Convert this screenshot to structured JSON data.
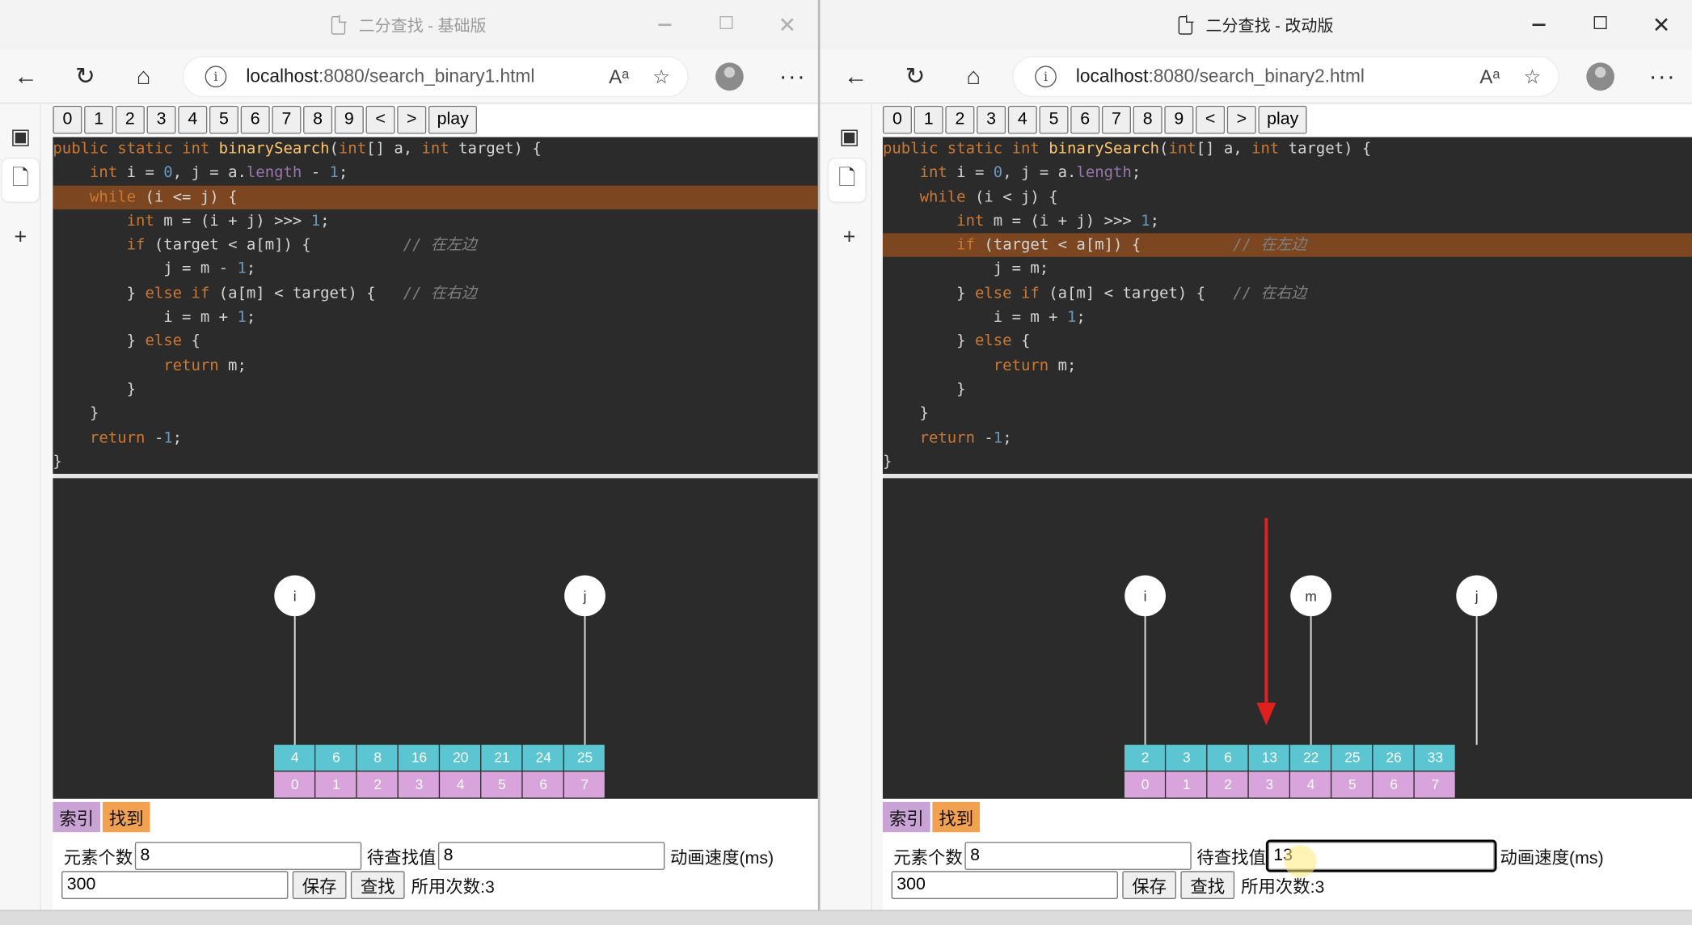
{
  "colors": {
    "code_bg": "#2b2b2b",
    "highlight": "#7b4620",
    "value_cell": "#5bc6d1",
    "index_cell": "#d9a3dc",
    "arrow": "#e0201e",
    "legend_index": "#c9a2d6",
    "legend_found": "#f2a151"
  },
  "left": {
    "title": "二分查找 - 基础版",
    "url_host": "localhost",
    "url_path": ":8080/search_binary1.html",
    "buttons": [
      "0",
      "1",
      "2",
      "3",
      "4",
      "5",
      "6",
      "7",
      "8",
      "9",
      "<",
      ">",
      "play"
    ],
    "code_lines": [
      "public static int binarySearch(int[] a, int target) {",
      "    int i = 0, j = a.length - 1;",
      "    while (i <= j) {",
      "        int m = (i + j) >>> 1;",
      "        if (target < a[m]) {          // 在左边",
      "            j = m - 1;",
      "        } else if (a[m] < target) {   // 在右边",
      "            i = m + 1;",
      "        } else {",
      "            return m;",
      "        }",
      "    }",
      "    return -1;",
      "}"
    ],
    "highlight_line": 2,
    "values": [
      "4",
      "6",
      "8",
      "16",
      "20",
      "21",
      "24",
      "25"
    ],
    "indices": [
      "0",
      "1",
      "2",
      "3",
      "4",
      "5",
      "6",
      "7"
    ],
    "pointers": [
      {
        "label": "i",
        "index": 0
      },
      {
        "label": "j",
        "index": 7
      }
    ],
    "legend_index": "索引",
    "legend_found": "找到",
    "count_label": "元素个数",
    "count_value": "8",
    "target_label": "待查找值",
    "target_value": "8",
    "speed_label": "动画速度(ms)",
    "speed_value": "300",
    "save_label": "保存",
    "search_label": "查找",
    "attempts_label": "所用次数:3"
  },
  "right": {
    "title": "二分查找 - 改动版",
    "url_host": "localhost",
    "url_path": ":8080/search_binary2.html",
    "buttons": [
      "0",
      "1",
      "2",
      "3",
      "4",
      "5",
      "6",
      "7",
      "8",
      "9",
      "<",
      ">",
      "play"
    ],
    "code_lines": [
      "public static int binarySearch(int[] a, int target) {",
      "    int i = 0, j = a.length;",
      "    while (i < j) {",
      "        int m = (i + j) >>> 1;",
      "        if (target < a[m]) {          // 在左边",
      "            j = m;",
      "        } else if (a[m] < target) {   // 在右边",
      "            i = m + 1;",
      "        } else {",
      "            return m;",
      "        }",
      "    }",
      "    return -1;",
      "}"
    ],
    "highlight_line": 4,
    "values": [
      "2",
      "3",
      "6",
      "13",
      "22",
      "25",
      "26",
      "33"
    ],
    "indices": [
      "0",
      "1",
      "2",
      "3",
      "4",
      "5",
      "6",
      "7"
    ],
    "pointers": [
      {
        "label": "i",
        "index": 0
      },
      {
        "label": "m",
        "index": 4
      },
      {
        "label": "j",
        "index": 8
      }
    ],
    "arrow_index": 3,
    "legend_index": "索引",
    "legend_found": "找到",
    "count_label": "元素个数",
    "count_value": "8",
    "target_label": "待查找值",
    "target_value": "13",
    "speed_label": "动画速度(ms)",
    "speed_value": "300",
    "save_label": "保存",
    "search_label": "查找",
    "attempts_label": "所用次数:3"
  }
}
